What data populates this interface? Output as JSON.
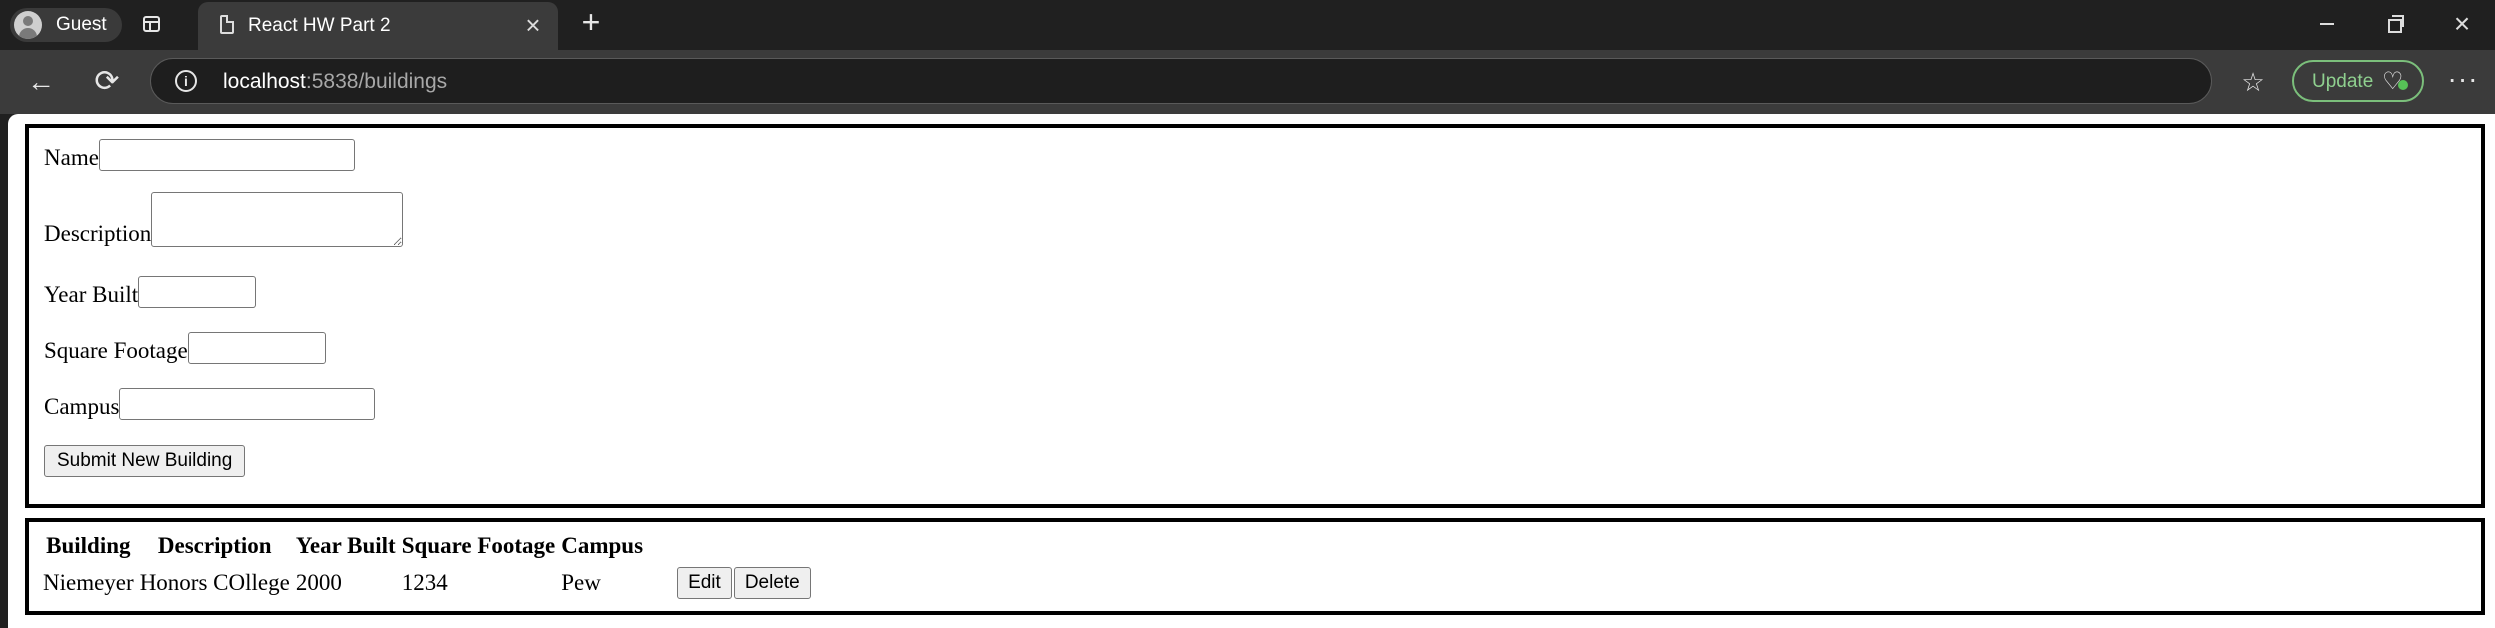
{
  "browser": {
    "profile_label": "Guest",
    "tab_title": "React HW Part 2",
    "url_host": "localhost",
    "url_rest": ":5838/buildings",
    "update_label": "Update",
    "accent_update": "#8fd08f"
  },
  "icons": {
    "back": "←",
    "refresh": "⟳",
    "info": "i",
    "favorites": "☆",
    "more": "···",
    "new_tab": "+",
    "close": "×",
    "heart": "♡"
  },
  "form": {
    "name_label": "Name",
    "name_value": "",
    "description_label": "Description",
    "description_value": "",
    "year_label": "Year Built",
    "year_value": "",
    "sqft_label": "Square Footage",
    "sqft_value": "",
    "campus_label": "Campus",
    "campus_value": "",
    "submit_label": "Submit New Building"
  },
  "table": {
    "headers": [
      "Building",
      "Description",
      "Year Built",
      "Square Footage",
      "Campus"
    ],
    "rows": [
      {
        "building": "Niemeyer",
        "description": "Honors COllege",
        "year_built": "2000",
        "square_footage": "1234",
        "campus": "Pew",
        "edit_label": "Edit",
        "delete_label": "Delete"
      }
    ]
  }
}
